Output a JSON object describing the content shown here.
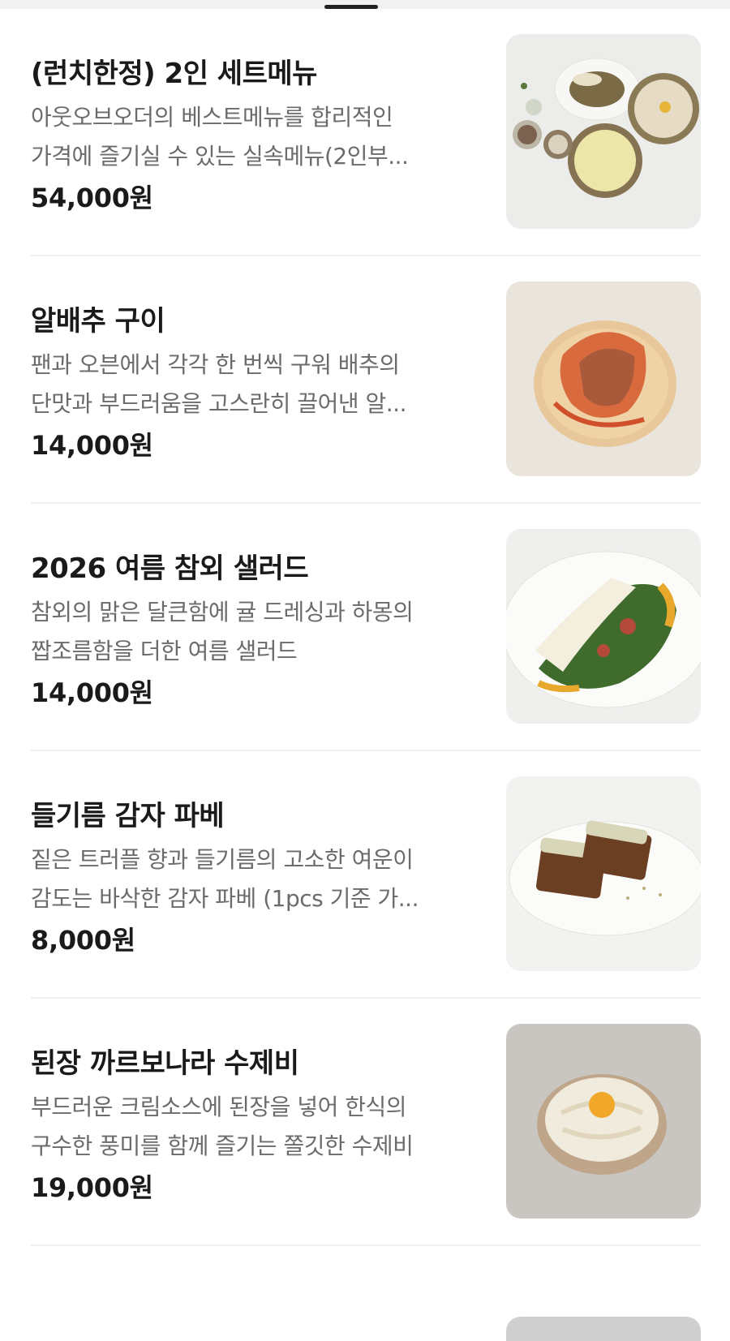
{
  "menu": {
    "items": [
      {
        "title": "(런치한정) 2인 세트메뉴",
        "desc_line1": "아웃오브오더의 베스트메뉴를 합리적인",
        "desc_line2": "가격에 즐기실 수 있는 실속메뉴(2인부...",
        "price": "54,000원",
        "image": "lunch-set-dishes"
      },
      {
        "title": "알배추 구이",
        "desc_line1": "팬과 오븐에서 각각 한 번씩 구워 배추의",
        "desc_line2": "단맛과 부드러움을 고스란히 끌어낸 알...",
        "price": "14,000원",
        "image": "grilled-cabbage"
      },
      {
        "title": "2026 여름 참외 샐러드",
        "desc_line1": "참외의 맑은 달큰함에 귤 드레싱과 하몽의",
        "desc_line2": "짭조름함을 더한 여름 샐러드",
        "price": "14,000원",
        "image": "melon-salad"
      },
      {
        "title": "들기름 감자 파베",
        "desc_line1": "짙은 트러플 향과 들기름의 고소한 여운이",
        "desc_line2": "감도는 바삭한 감자 파베 (1pcs 기준 가...",
        "price": "8,000원",
        "image": "potato-pave"
      },
      {
        "title": "된장 까르보나라 수제비",
        "desc_line1": "부드러운 크림소스에 된장을 넣어 한식의",
        "desc_line2": "구수한 풍미를 함께 즐기는 쫄깃한 수제비",
        "price": "19,000원",
        "image": "doenjang-carbonara-sujebi"
      }
    ]
  }
}
